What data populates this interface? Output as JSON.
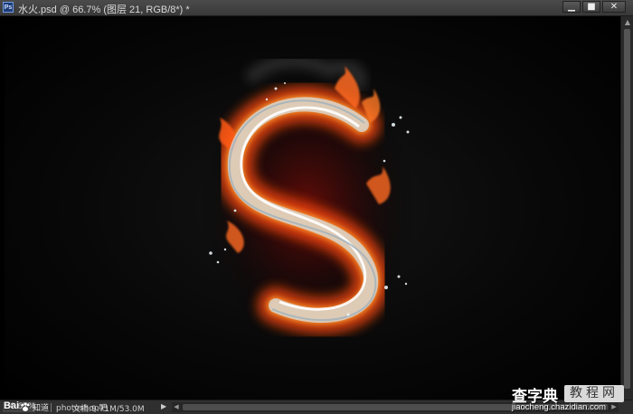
{
  "window": {
    "app_badge": "Ps",
    "title": "水火.psd @ 66.7% (图层 21, RGB/8*) *",
    "controls": {
      "minimize": "▁",
      "maximize": "■",
      "close": "✕"
    }
  },
  "canvas": {
    "artwork": "S",
    "colors": {
      "fire": "#ff5a1a",
      "fire_core": "#ffb347",
      "water": "#e8eef2",
      "background": "#000000"
    }
  },
  "statusbar": {
    "zoom": "66.67%",
    "logo_text": "Bai",
    "logo_suffix": "知道",
    "site": "photoshop吧",
    "doc_size": "文档:9.71M/53.0M",
    "arrow": "▶"
  },
  "watermark": {
    "cha_zi_dian": "查字典",
    "jiao_cheng_wang": "教程网",
    "url": "jiaocheng.chazidian.com"
  }
}
